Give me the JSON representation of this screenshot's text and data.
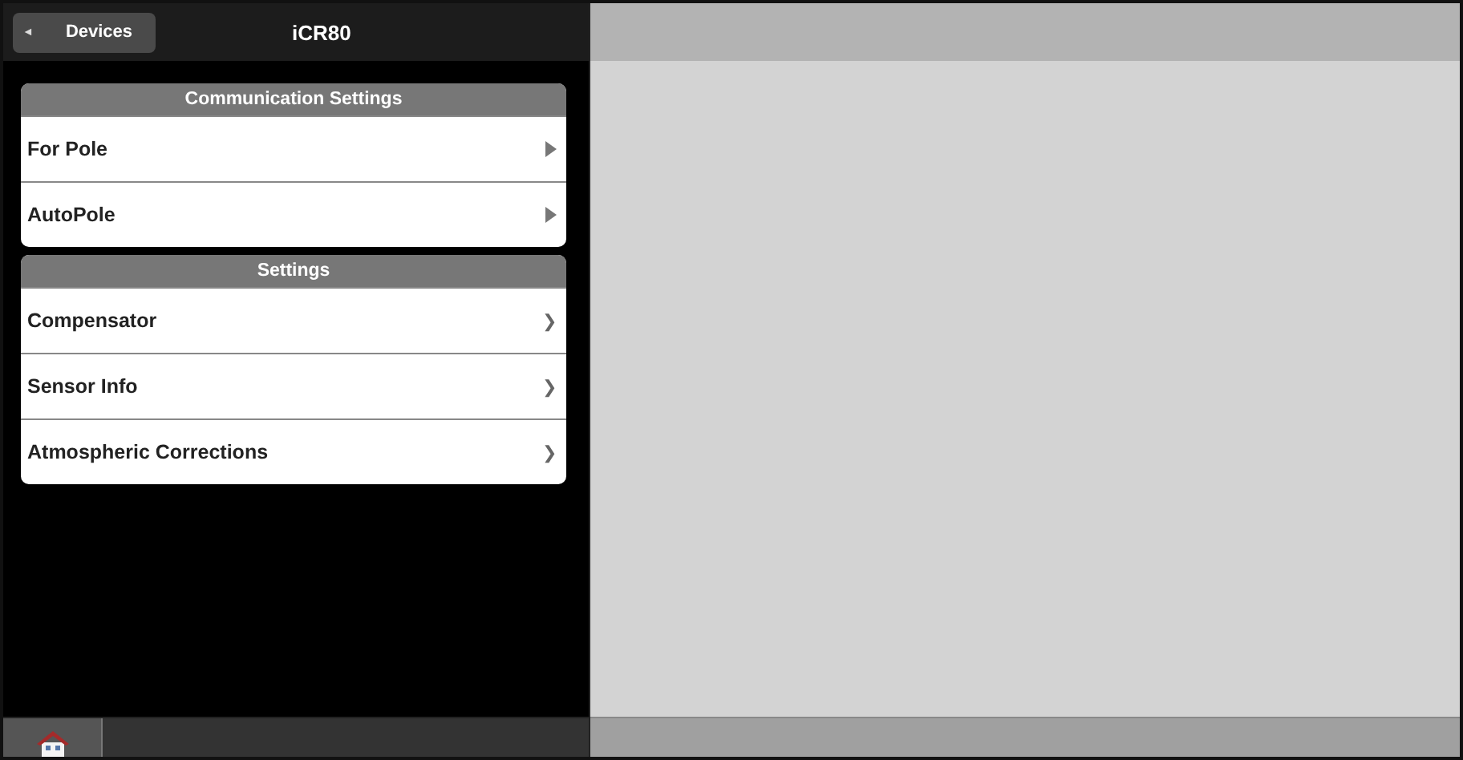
{
  "header": {
    "back_button": {
      "icon": "◄",
      "label": "Devices"
    },
    "title": "iCR80"
  },
  "sections": [
    {
      "title": "Communication Settings",
      "items": [
        {
          "label": "For Pole",
          "kind": "triangle"
        },
        {
          "label": "AutoPole",
          "kind": "triangle"
        }
      ]
    },
    {
      "title": "Settings",
      "items": [
        {
          "label": "Compensator",
          "kind": "chevron",
          "arrow": "❯"
        },
        {
          "label": "Sensor Info",
          "kind": "chevron",
          "arrow": "❯"
        },
        {
          "label": "Atmospheric Corrections",
          "kind": "chevron",
          "arrow": "❯"
        }
      ]
    }
  ]
}
